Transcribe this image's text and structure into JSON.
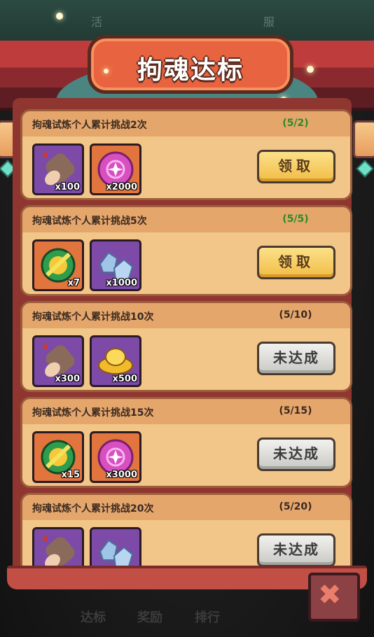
{
  "header": {
    "title": "拘魂达标",
    "bg_text_left": "活",
    "bg_text_right": "服"
  },
  "tasks": [
    {
      "title": "拘魂试炼个人累计挑战2次",
      "progress": "(5/2)",
      "done": true,
      "button": "领取",
      "rewards": [
        {
          "icon": "wood-log-icon",
          "count": "x100"
        },
        {
          "icon": "purple-orb-icon",
          "count": "x2000"
        }
      ]
    },
    {
      "title": "拘魂试炼个人累计挑战5次",
      "progress": "(5/5)",
      "done": true,
      "button": "领取",
      "rewards": [
        {
          "icon": "green-gold-medallion-icon",
          "count": "x7"
        },
        {
          "icon": "blue-crystal-ore-icon",
          "count": "x1000"
        }
      ]
    },
    {
      "title": "拘魂试炼个人累计挑战10次",
      "progress": "(5/10)",
      "done": false,
      "button": "未达成",
      "rewards": [
        {
          "icon": "wood-log-icon",
          "count": "x300"
        },
        {
          "icon": "gold-ingot-icon",
          "count": "x500"
        }
      ]
    },
    {
      "title": "拘魂试炼个人累计挑战15次",
      "progress": "(5/15)",
      "done": false,
      "button": "未达成",
      "rewards": [
        {
          "icon": "green-gold-medallion-icon",
          "count": "x15"
        },
        {
          "icon": "purple-orb-icon",
          "count": "x3000"
        }
      ]
    },
    {
      "title": "拘魂试炼个人累计挑战20次",
      "progress": "(5/20)",
      "done": false,
      "button": "未达成",
      "rewards": [
        {
          "icon": "wood-log-icon",
          "count": ""
        },
        {
          "icon": "blue-crystal-ore-icon",
          "count": ""
        }
      ]
    }
  ],
  "bottom_nav": [
    "达标",
    "奖励",
    "排行"
  ],
  "colors": {
    "claim": "#f2bd45",
    "locked": "#c8c8c4",
    "done_progress": "#2b8a2b",
    "card": "#f1c688"
  }
}
